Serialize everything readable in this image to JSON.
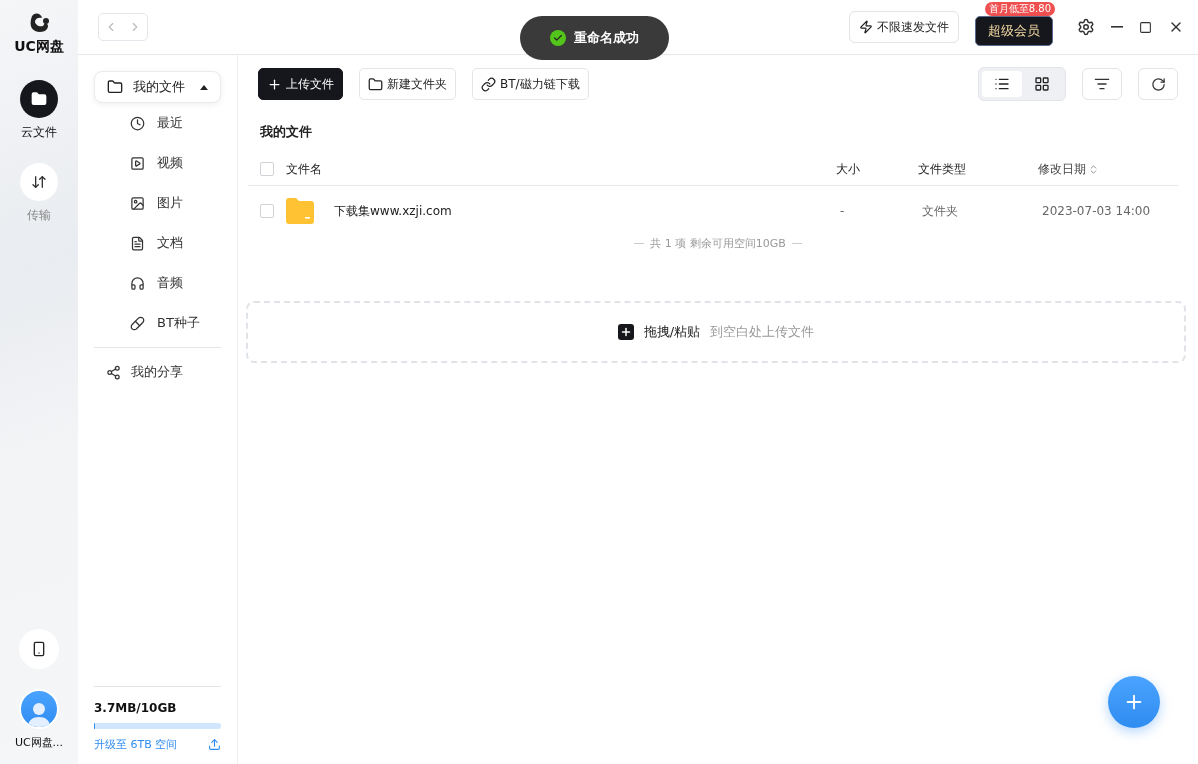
{
  "app": {
    "logo_text": "UC网盘"
  },
  "rail": {
    "items": [
      {
        "kind": "cloud",
        "label": "云文件",
        "selected": true
      },
      {
        "kind": "transfer",
        "label": "传输",
        "selected": false
      }
    ],
    "user_name": "UC网盘..."
  },
  "topbar": {
    "fast_send": "不限速发文件",
    "vip": {
      "label": "超级会员",
      "badge": "首月低至8.80"
    }
  },
  "toast": {
    "text": "重命名成功"
  },
  "sidebar": {
    "root": {
      "label": "我的文件",
      "expanded": true,
      "selected": true,
      "children": [
        {
          "kind": "recent",
          "label": "最近"
        },
        {
          "kind": "video",
          "label": "视频"
        },
        {
          "kind": "image",
          "label": "图片"
        },
        {
          "kind": "doc",
          "label": "文档"
        },
        {
          "kind": "audio",
          "label": "音频"
        },
        {
          "kind": "bt",
          "label": "BT种子"
        }
      ]
    },
    "share": "我的分享",
    "storage": {
      "usage": "3.7MB/10GB",
      "level": 0.01,
      "upgrade": "升级至 6TB 空间"
    }
  },
  "toolbar": {
    "buttons": [
      {
        "kind": "upload",
        "label": "上传文件"
      },
      {
        "kind": "folder",
        "label": "新建文件夹"
      },
      {
        "kind": "link",
        "label": "BT/磁力链下载"
      }
    ],
    "views": [
      {
        "kind": "list",
        "selected": true
      },
      {
        "kind": "grid",
        "selected": false
      }
    ]
  },
  "breadcrumb": "我的文件",
  "table": {
    "all_checked": false,
    "columns": [
      "文件名",
      "大小",
      "文件类型",
      "修改日期"
    ],
    "rows": [
      {
        "name": "下载集www.xzji.com",
        "size": "-",
        "type": "文件夹",
        "date": "2023-07-03 14:00",
        "checked": false
      }
    ],
    "footer": "共 1 项 剩余可用空间10GB"
  },
  "dropzone": {
    "action": "拖拽/粘贴",
    "hint": "到空白处上传文件"
  }
}
